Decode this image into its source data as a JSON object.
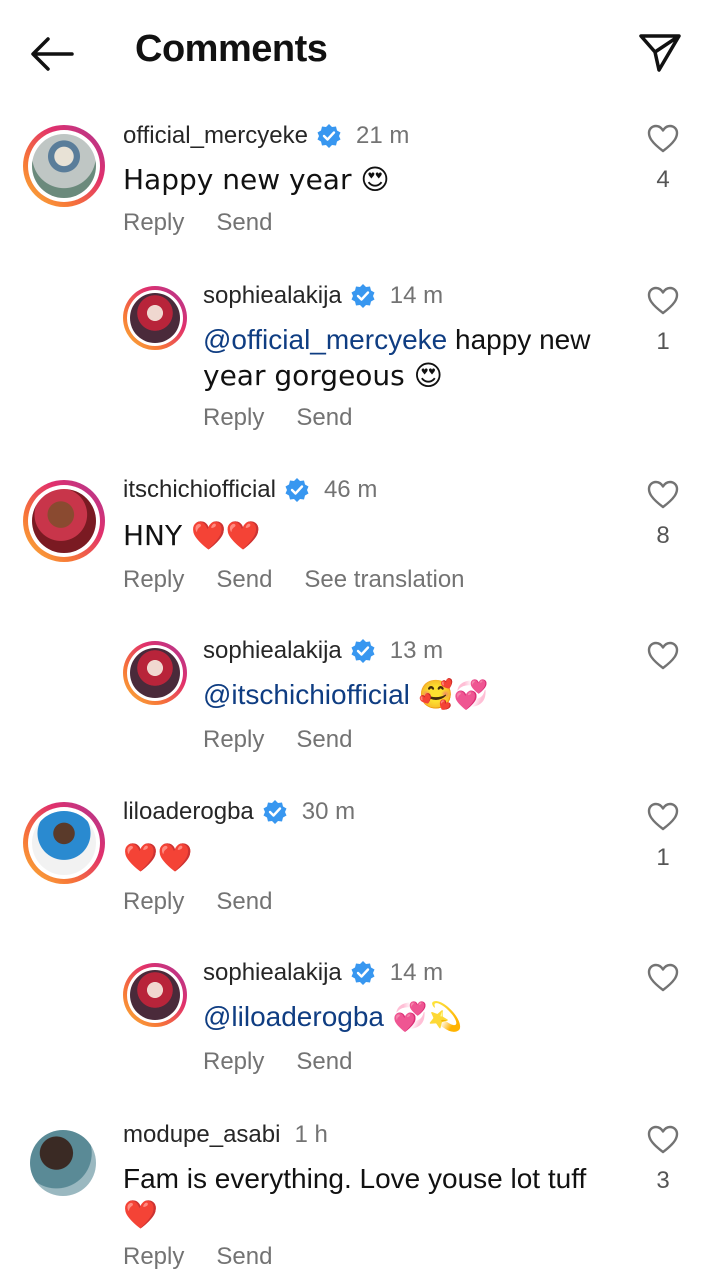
{
  "header": {
    "title": "Comments",
    "back_icon": "arrow-left-icon",
    "share_icon": "paper-plane-icon"
  },
  "actions": {
    "reply": "Reply",
    "send": "Send",
    "see_translation": "See translation"
  },
  "comments": [
    {
      "username": "official_mercyeke",
      "verified": true,
      "time": "21 m",
      "text": "Happy new year 😍",
      "likes": "4"
    },
    {
      "username": "sophiealakija",
      "verified": true,
      "time": "14 m",
      "mention": "@official_mercyeke",
      "text_line1": " happy new",
      "text_line2": "year gorgeous 😍",
      "likes": "1"
    },
    {
      "username": "itschichiofficial",
      "verified": true,
      "time": "46 m",
      "text": "HNY ❤️❤️",
      "likes": "8"
    },
    {
      "username": "sophiealakija",
      "verified": true,
      "time": "13 m",
      "mention": "@itschichiofficial",
      "text": " 🥰💞",
      "likes": ""
    },
    {
      "username": "liloaderogba",
      "verified": true,
      "time": "30 m",
      "text": "❤️❤️",
      "likes": "1"
    },
    {
      "username": "sophiealakija",
      "verified": true,
      "time": "14 m",
      "mention": "@liloaderogba",
      "text": " 💞💫",
      "likes": ""
    },
    {
      "username": "modupe_asabi",
      "verified": false,
      "time": "1 h",
      "text_line1": "Fam is everything. Love youse lot tuff",
      "text_line2": "❤️",
      "likes": "3"
    }
  ],
  "colors": {
    "verified_badge": "#3897f0",
    "mention": "#0f3d82",
    "muted": "#737373"
  }
}
